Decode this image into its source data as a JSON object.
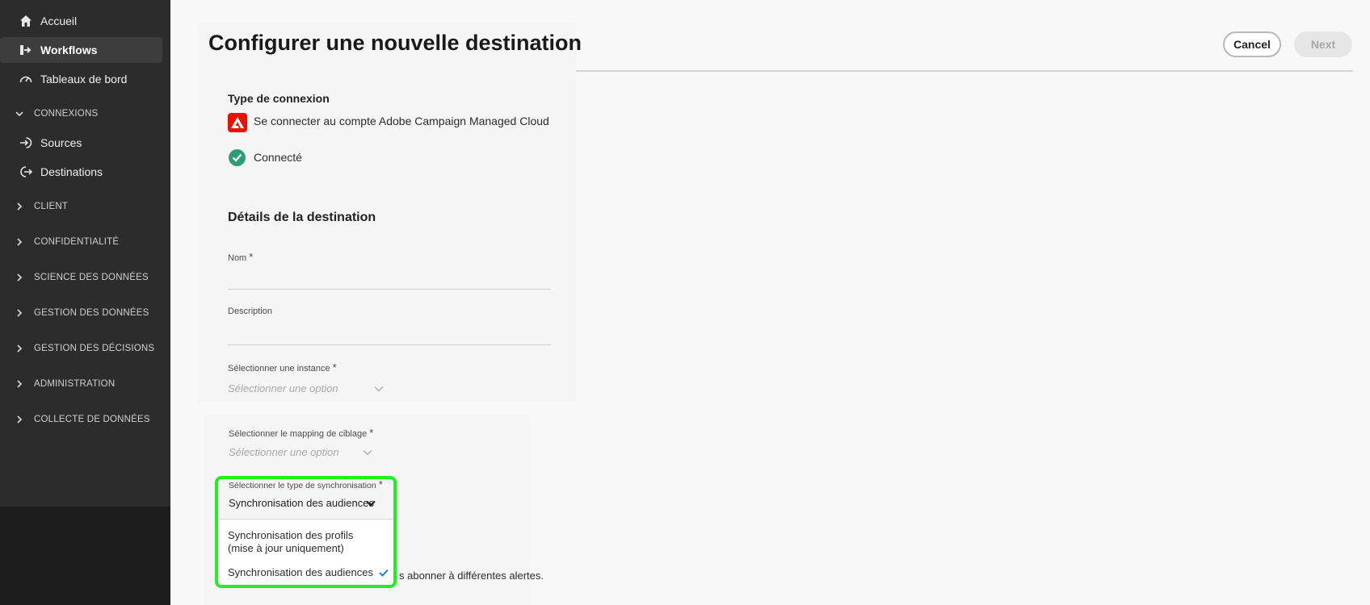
{
  "sidebar": {
    "items": [
      {
        "label": "Accueil",
        "icon": "home-icon"
      },
      {
        "label": "Workflows",
        "icon": "workflow-icon"
      },
      {
        "label": "Tableaux de bord",
        "icon": "dashboard-icon"
      }
    ],
    "sections": [
      {
        "label": "CONNEXIONS",
        "expanded": true
      },
      {
        "label": "CLIENT"
      },
      {
        "label": "CONFIDENTIALITÉ"
      },
      {
        "label": "SCIENCE DES DONNÉES"
      },
      {
        "label": "GESTION DES DONNÉES"
      },
      {
        "label": "GESTION DES DÉCISIONS"
      },
      {
        "label": "ADMINISTRATION"
      },
      {
        "label": "COLLECTE DE DONNÉES"
      }
    ],
    "connexions_items": [
      {
        "label": "Sources",
        "icon": "sources-icon"
      },
      {
        "label": "Destinations",
        "icon": "destinations-icon"
      }
    ]
  },
  "header": {
    "title": "Configurer une nouvelle destination",
    "cancel_label": "Cancel",
    "next_label": "Next"
  },
  "connection": {
    "type_label": "Type de connexion",
    "account_text": "Se connecter au compte Adobe Campaign Managed Cloud",
    "status_text": "Connecté"
  },
  "details": {
    "heading": "Détails de la destination",
    "name_label": "Nom",
    "description_label": "Description",
    "instance_label": "Sélectionner une instance",
    "instance_placeholder": "Sélectionner une option",
    "mapping_label": "Sélectionner le mapping de ciblage",
    "mapping_placeholder": "Sélectionner une option",
    "sync_label": "Sélectionner le type de synchronisation",
    "sync_value": "Synchronisation des audiences",
    "sync_options": [
      "Synchronisation des profils (mise à jour uniquement)",
      "Synchronisation des audiences"
    ],
    "alerts_text_partial": "s abonner à différentes alertes."
  },
  "required_marker": "*",
  "colors": {
    "sidebar_bg": "#2c2c2c",
    "highlight": "#22ee22",
    "adobe_red": "#eb1000",
    "success_green": "#2d9d78",
    "check_blue": "#1473e6"
  }
}
